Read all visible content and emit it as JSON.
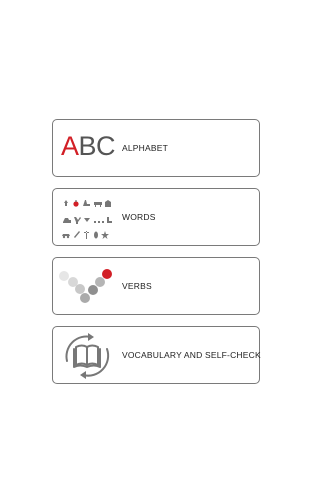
{
  "menu": {
    "items": [
      {
        "id": "alphabet",
        "label": "ALPHABET",
        "icon": "abc-logo-icon"
      },
      {
        "id": "words",
        "label": "WORDS",
        "icon": "word-pictograms-icon"
      },
      {
        "id": "verbs",
        "label": "VERBS",
        "icon": "verb-dots-check-icon"
      },
      {
        "id": "vocabulary",
        "label": "VOCABULARY AND SELF-CHECK",
        "icon": "book-refresh-icon"
      }
    ]
  },
  "alphabet_logo": {
    "first_letter": "A",
    "rest_letters": "BC"
  },
  "colors": {
    "accent": "#d21f26",
    "text": "#222222",
    "border": "#7a7a7a",
    "icon_gray": "#777777"
  }
}
